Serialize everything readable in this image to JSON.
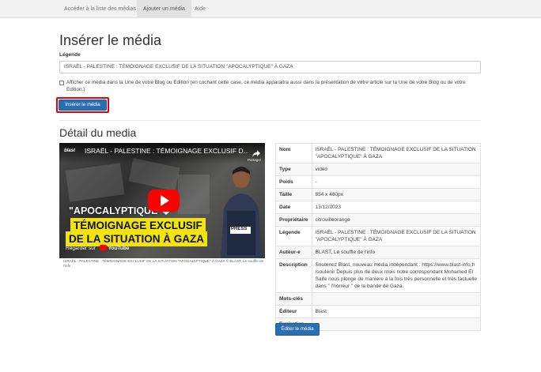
{
  "nav": {
    "tabs": [
      {
        "label": "Accéder à la liste des médias",
        "active": false
      },
      {
        "label": "Ajouter un média",
        "active": true
      },
      {
        "label": "Aide",
        "active": false
      }
    ]
  },
  "insert": {
    "title": "Insérer le média",
    "legend_label": "Légende",
    "legend_value": "ISRAËL - PALESTINE : TÉMOIGNAGE EXCLUSIF DE LA SITUATION \"APOCALYPTIQUE\" À GAZA",
    "checkbox_text": "Afficher ce média dans la Une de votre Blog ou Edition (en cochant cette case, ce média apparaitra aussi dans la présentation de votre article sur la Une de votre Blog ou de votre Edition.)",
    "checkbox_checked": false,
    "button_label": "Insérer le média"
  },
  "detail": {
    "title": "Détail du media",
    "video": {
      "channel_logo": "blast",
      "title": "ISRAËL - PALESTINE : TÉMOIGNAGE EXCLUSIF D...",
      "share_label": "Partager",
      "thumb_line1": "\"APOCALYPTIQUE\"",
      "thumb_line2": "TÉMOIGNAGE EXCLUSIF",
      "thumb_line3": "DE LA SITUATION À GAZA",
      "vest_label": "PRESS",
      "watch_label": "Regarder sur",
      "youtube_label": "YouTube",
      "caption": "ISRAËL - PALESTINE : TÉMOIGNAGE EXCLUSIF DE LA SITUATION \"APOCALYPTIQUE\" À GAZA © BLAST, Le souffle de l'info"
    },
    "rows": [
      {
        "key": "Nom",
        "value": "ISRAËL - PALESTINE : TÉMOIGNAGE EXCLUSIF DE LA SITUATION \"APOCALYPTIQUE\" À GAZA"
      },
      {
        "key": "Type",
        "value": "video"
      },
      {
        "key": "Poids",
        "value": "-"
      },
      {
        "key": "Taille",
        "value": "854 x 480px"
      },
      {
        "key": "Date",
        "value": "13/12/2023"
      },
      {
        "key": "Propriétaire",
        "value": "citrouilleorange"
      },
      {
        "key": "Légende",
        "value": "ISRAËL - PALESTINE : TÉMOIGNAGE EXCLUSIF DE LA SITUATION \"APOCALYPTIQUE\" À GAZA"
      },
      {
        "key": "Auteur-e",
        "value": "BLAST, Le souffle de l'info"
      },
      {
        "key": "Description",
        "value": "Soutenez Blast, nouveau média indépendant : https://www.blast-info.fr /soutenir Depuis plus de deux mois notre correspondant Mohamed El Saife nous plonge de manière à la fois très personnelle et très factuelle dans \" l'horreur \" de la bande de Gaza."
      },
      {
        "key": "Mots-clés",
        "value": ""
      },
      {
        "key": "Éditeur",
        "value": "Blast"
      },
      {
        "key": "Expiration",
        "value": ""
      }
    ],
    "edit_button_label": "Éditer le média"
  },
  "colors": {
    "primary_button": "#2c6fb0",
    "highlight_outline": "#e0000f",
    "thumbnail_yellow": "#f2e313",
    "youtube_red": "#ff0000"
  }
}
